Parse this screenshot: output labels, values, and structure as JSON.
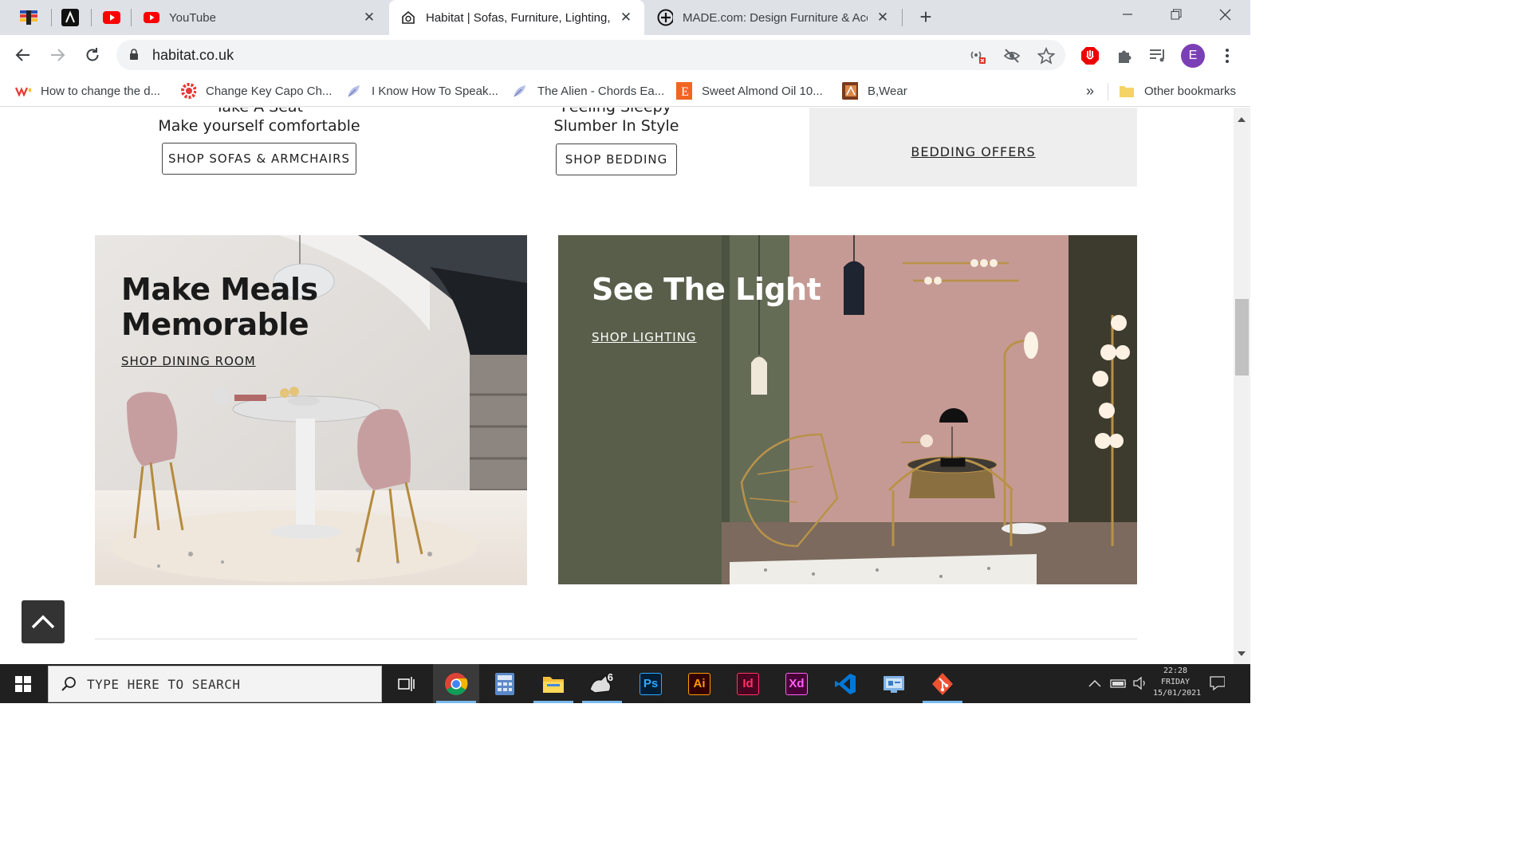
{
  "browser": {
    "tabs": [
      {
        "title": "YouTube",
        "icon": "youtube-icon"
      },
      {
        "title": "Habitat | Sofas, Furniture, Lighting, H",
        "icon": "habitat-icon",
        "active": true
      },
      {
        "title": "MADE.com: Design Furniture & Acce",
        "icon": "made-icon"
      }
    ],
    "close_glyph": "✕",
    "new_tab_glyph": "+",
    "url": "habitat.co.uk",
    "profile_initial": "E",
    "bookmarks": [
      {
        "label": "How to change the d...",
        "icon": "ws-icon"
      },
      {
        "label": "Change Key Capo Ch...",
        "icon": "gear-red-icon"
      },
      {
        "label": "I Know How To Speak...",
        "icon": "feather-icon"
      },
      {
        "label": "The Alien - Chords Ea...",
        "icon": "feather-icon"
      },
      {
        "label": "Sweet Almond Oil 10...",
        "icon": "etsy-icon"
      },
      {
        "label": "B,Wear",
        "icon": "bwear-icon"
      }
    ],
    "bookmarks_overflow": "»",
    "other_bookmarks": "Other bookmarks"
  },
  "page": {
    "promo_left": {
      "cut_title": "Take A Seat",
      "subtitle": "Make yourself comfortable",
      "button": "SHOP SOFAS & ARMCHAIRS"
    },
    "promo_mid": {
      "cut_title": "Feeling Sleepy",
      "subtitle": "Slumber In Style",
      "button": "SHOP BEDDING"
    },
    "promo_right": {
      "link": "BEDDING OFFERS"
    },
    "hero_dining": {
      "title_line1": "Make Meals",
      "title_line2": "Memorable",
      "link": "SHOP DINING ROOM"
    },
    "hero_lighting": {
      "title": "See The Light",
      "link": "SHOP LIGHTING"
    }
  },
  "taskbar": {
    "search_placeholder": "TYPE HERE TO SEARCH",
    "apps": [
      "chrome",
      "calculator",
      "file-explorer",
      "rhino-6",
      "photoshop",
      "illustrator",
      "indesign",
      "xd",
      "vscode",
      "control-panel",
      "git"
    ],
    "app_labels": {
      "photoshop": "Ps",
      "illustrator": "Ai",
      "indesign": "Id",
      "xd": "Xd",
      "rhino": "6"
    },
    "clock_time": "22:28",
    "clock_day": "FRIDAY",
    "clock_date": "15/01/2021"
  },
  "colors": {
    "chrome_frame": "#dee1e6",
    "taskbar": "#202020",
    "profile": "#7b3fb5",
    "lighting_green": "#5f6650",
    "lighting_pink": "#c69a94"
  }
}
